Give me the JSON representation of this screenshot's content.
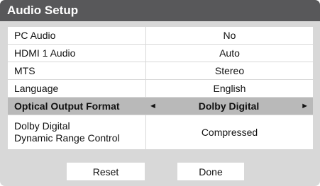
{
  "title": "Audio Setup",
  "rows": [
    {
      "label": "PC Audio",
      "value": "No"
    },
    {
      "label": "HDMI 1 Audio",
      "value": "Auto"
    },
    {
      "label": "MTS",
      "value": "Stereo"
    },
    {
      "label": "Language",
      "value": "English"
    },
    {
      "label": "Optical Output Format",
      "value": "Dolby Digital",
      "left_arrow": "◄",
      "right_arrow": "►",
      "selected": true
    },
    {
      "label_line1": "Dolby Digital",
      "label_line2": "Dynamic Range Control",
      "value": "Compressed"
    }
  ],
  "buttons": {
    "reset": "Reset",
    "done": "Done"
  },
  "colors": {
    "title_bar": "#58585a",
    "panel_bg": "#d8d8d8",
    "selected_row": "#b9b9b9"
  }
}
